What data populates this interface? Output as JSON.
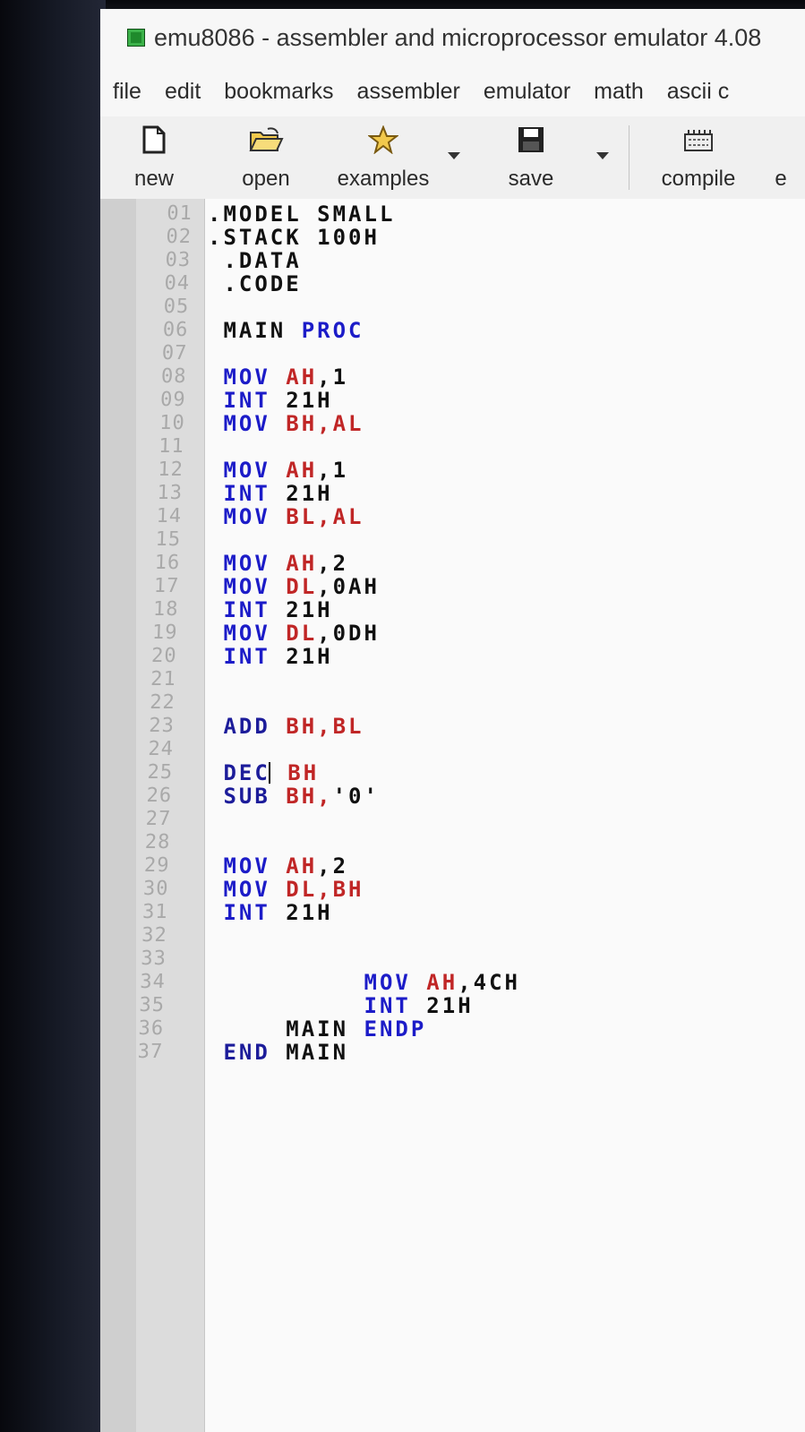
{
  "window": {
    "title": "emu8086 - assembler and microprocessor emulator 4.08"
  },
  "menu": [
    "file",
    "edit",
    "bookmarks",
    "assembler",
    "emulator",
    "math",
    "ascii c"
  ],
  "toolbar": {
    "new": "new",
    "open": "open",
    "examples": "examples",
    "save": "save",
    "compile": "compile",
    "cut_off": "e"
  },
  "line_numbers": [
    "01",
    "02",
    "03",
    "04",
    "05",
    "06",
    "07",
    "08",
    "09",
    "10",
    "11",
    "12",
    "13",
    "14",
    "15",
    "16",
    "17",
    "18",
    "19",
    "20",
    "21",
    "22",
    "23",
    "24",
    "25",
    "26",
    "27",
    "28",
    "29",
    "30",
    "31",
    "32",
    "33",
    "34",
    "35",
    "36",
    "37"
  ],
  "code_lines": [
    [
      {
        "t": ".MODEL SMALL",
        "c": "num"
      }
    ],
    [
      {
        "t": ".STACK 100H",
        "c": "num"
      }
    ],
    [
      {
        "t": " .DATA",
        "c": "num"
      }
    ],
    [
      {
        "t": " .CODE",
        "c": "num"
      }
    ],
    [],
    [
      {
        "t": " MAIN ",
        "c": "num"
      },
      {
        "t": "PROC",
        "c": "kw"
      }
    ],
    [],
    [
      {
        "t": " MOV ",
        "c": "kw"
      },
      {
        "t": "AH",
        "c": "reg"
      },
      {
        "t": ",1",
        "c": "num"
      }
    ],
    [
      {
        "t": " INT ",
        "c": "kw"
      },
      {
        "t": "21H",
        "c": "num"
      }
    ],
    [
      {
        "t": " MOV ",
        "c": "kw"
      },
      {
        "t": "BH,AL",
        "c": "reg"
      }
    ],
    [],
    [
      {
        "t": " MOV ",
        "c": "kw"
      },
      {
        "t": "AH",
        "c": "reg"
      },
      {
        "t": ",1",
        "c": "num"
      }
    ],
    [
      {
        "t": " INT ",
        "c": "kw"
      },
      {
        "t": "21H",
        "c": "num"
      }
    ],
    [
      {
        "t": " MOV ",
        "c": "kw"
      },
      {
        "t": "BL,AL",
        "c": "reg"
      }
    ],
    [],
    [
      {
        "t": " MOV ",
        "c": "kw"
      },
      {
        "t": "AH",
        "c": "reg"
      },
      {
        "t": ",2",
        "c": "num"
      }
    ],
    [
      {
        "t": " MOV ",
        "c": "kw"
      },
      {
        "t": "DL",
        "c": "reg"
      },
      {
        "t": ",0AH",
        "c": "num"
      }
    ],
    [
      {
        "t": " INT ",
        "c": "kw"
      },
      {
        "t": "21H",
        "c": "num"
      }
    ],
    [
      {
        "t": " MOV ",
        "c": "kw"
      },
      {
        "t": "DL",
        "c": "reg"
      },
      {
        "t": ",0DH",
        "c": "num"
      }
    ],
    [
      {
        "t": " INT ",
        "c": "kw"
      },
      {
        "t": "21H",
        "c": "num"
      }
    ],
    [],
    [],
    [
      {
        "t": " ADD ",
        "c": "kwd"
      },
      {
        "t": "BH,BL",
        "c": "reg"
      }
    ],
    [],
    [
      {
        "t": " DEC",
        "c": "kwd"
      },
      {
        "t": "",
        "c": "caret"
      },
      {
        "t": " BH",
        "c": "reg"
      }
    ],
    [
      {
        "t": " SUB ",
        "c": "kwd"
      },
      {
        "t": "BH,",
        "c": "reg"
      },
      {
        "t": "'0'",
        "c": "num"
      }
    ],
    [],
    [],
    [
      {
        "t": " MOV ",
        "c": "kw"
      },
      {
        "t": "AH",
        "c": "reg"
      },
      {
        "t": ",2",
        "c": "num"
      }
    ],
    [
      {
        "t": " MOV ",
        "c": "kw"
      },
      {
        "t": "DL,BH",
        "c": "reg"
      }
    ],
    [
      {
        "t": " INT ",
        "c": "kw"
      },
      {
        "t": "21H",
        "c": "num"
      }
    ],
    [],
    [],
    [
      {
        "t": "          MOV ",
        "c": "kw"
      },
      {
        "t": "AH",
        "c": "reg"
      },
      {
        "t": ",4CH",
        "c": "num"
      }
    ],
    [
      {
        "t": "          INT ",
        "c": "kw"
      },
      {
        "t": "21H",
        "c": "num"
      }
    ],
    [
      {
        "t": "     MAIN ",
        "c": "num"
      },
      {
        "t": "ENDP",
        "c": "kw"
      }
    ],
    [
      {
        "t": " END ",
        "c": "kwd"
      },
      {
        "t": "MAIN",
        "c": "num"
      }
    ]
  ]
}
